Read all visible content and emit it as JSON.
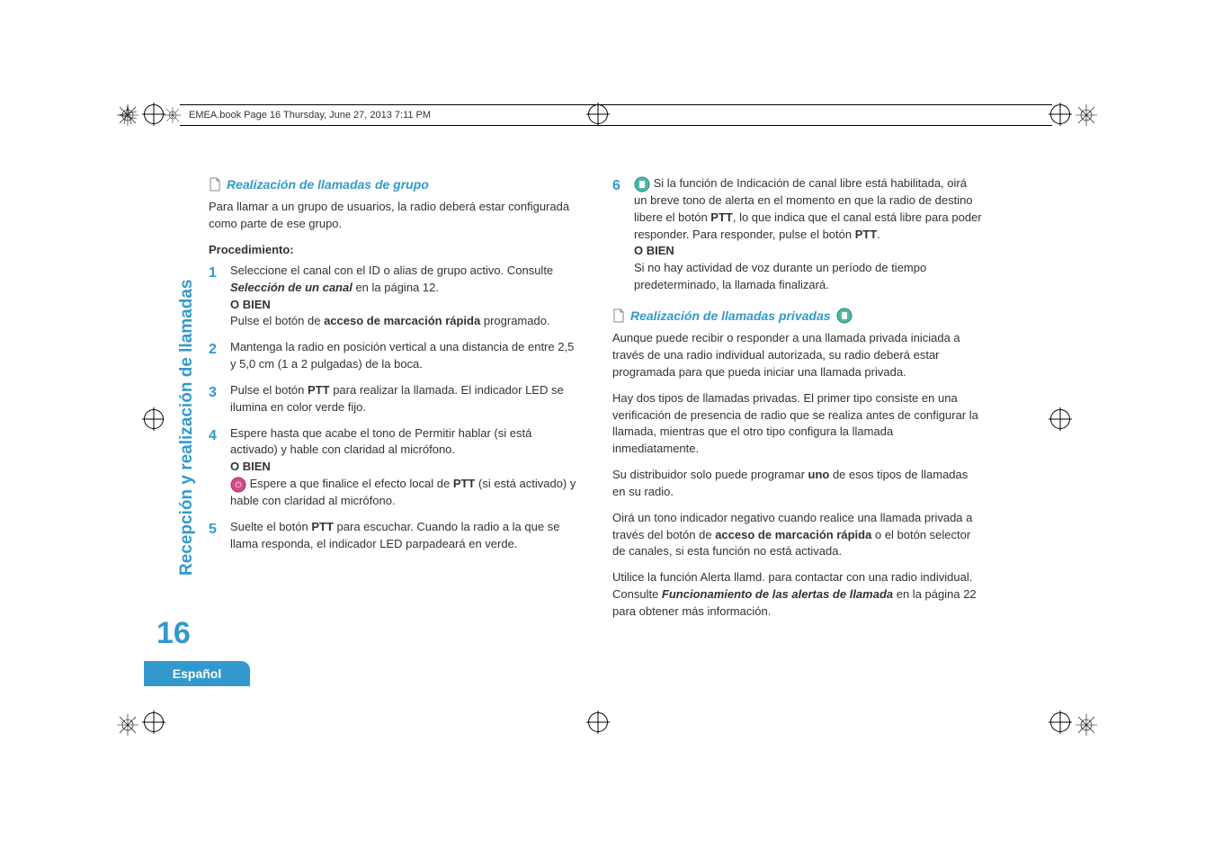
{
  "header": {
    "text": "EMEA.book  Page 16  Thursday, June 27, 2013  7:11 PM"
  },
  "sidebar": {
    "vertical_title": "Recepción y realización de llamadas",
    "page_number": "16",
    "language": "Español"
  },
  "col1": {
    "title1": "Realización de llamadas de grupo",
    "intro1": "Para llamar a un grupo de usuarios, la radio deberá estar configurada como parte de ese grupo.",
    "proc_label": "Procedimiento",
    "s1_a": "Seleccione el canal con el ID o alias de grupo activo. Consulte ",
    "s1_ref": "Selección de un canal",
    "s1_b": " en la página 12.",
    "obien": "O BIEN",
    "s1_c1": "Pulse el botón de ",
    "s1_c2": "acceso de marcación rápida",
    "s1_c3": " programado.",
    "s2": "Mantenga la radio en posición vertical a una distancia de entre 2,5 y 5,0 cm (1 a 2 pulgadas) de la boca.",
    "s3_a": "Pulse el botón ",
    "s3_ptt": "PTT",
    "s3_b": " para realizar la llamada. El indicador LED se ilumina en color verde fijo.",
    "s4_a": "Espere hasta que acabe el tono de Permitir hablar (si está activado) y hable con claridad al micrófono.",
    "s4_b": " Espere a que finalice el efecto local de ",
    "s4_c": " (si está activado) y hable con claridad al micrófono.",
    "s5_a": "Suelte el botón ",
    "s5_b": " para escuchar. Cuando la radio a la que se llama responda, el indicador LED parpadeará en verde."
  },
  "col2": {
    "s6_a": " Si la función de Indicación de canal libre está habilitada, oirá un breve tono de alerta en el momento en que la radio de destino libere el botón ",
    "s6_b": ", lo que indica que el canal está libre para poder responder. Para responder, pulse el botón ",
    "s6_c": ".",
    "s6_d": "Si no hay actividad de voz durante un período de tiempo predeterminado, la llamada finalizará.",
    "title2": "Realización de llamadas privadas",
    "p1": "Aunque puede recibir o responder a una llamada privada iniciada a través de una radio individual autorizada, su radio deberá estar programada para que pueda iniciar una llamada privada.",
    "p2": "Hay dos tipos de llamadas privadas. El primer tipo consiste en una verificación de presencia de radio que se realiza antes de configurar la llamada, mientras que el otro tipo configura la llamada inmediatamente.",
    "p3_a": "Su distribuidor solo puede programar ",
    "p3_b": "uno",
    "p3_c": " de esos tipos de llamadas en su radio.",
    "p4_a": "Oirá un tono indicador negativo cuando realice una llamada privada a través del botón de ",
    "p4_b": "acceso de marcación rápida",
    "p4_c": " o el botón selector de canales, si esta función no está activada.",
    "p5_a": "Utilice la función Alerta llamd. para contactar con una radio individual. Consulte ",
    "p5_ref": "Funcionamiento de las alertas de llamada",
    "p5_b": " en la página 22 para obtener más información."
  },
  "ptt": "PTT",
  "obien": "O BIEN"
}
